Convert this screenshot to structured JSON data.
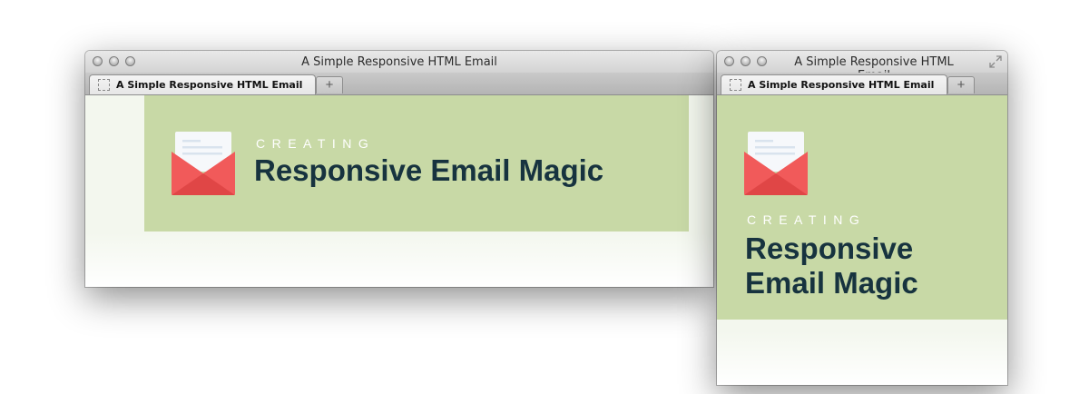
{
  "browser": {
    "window_title": "A Simple Responsive HTML Email",
    "tab_label": "A Simple Responsive HTML Email",
    "new_tab_label": "+"
  },
  "email": {
    "kicker": "CREATING",
    "headline": "Responsive Email Magic",
    "header_color": "#c8d9a6",
    "headline_color": "#17333f"
  },
  "icons": {
    "envelope": "envelope-icon",
    "favicon": "page-icon",
    "resize": "fullscreen-icon"
  }
}
